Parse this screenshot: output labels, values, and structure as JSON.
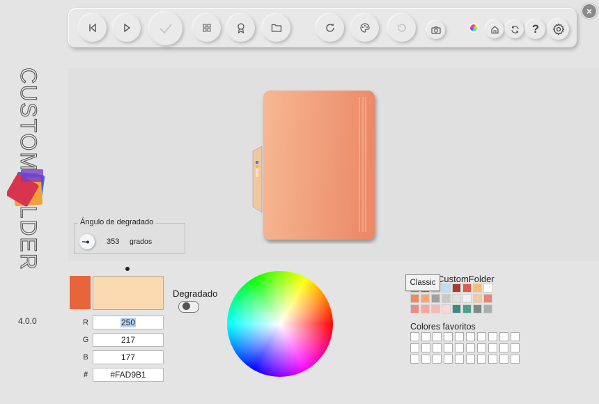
{
  "app": {
    "name": "CUSTOMFOLDER",
    "version": "4.0.0"
  },
  "window": {
    "close_icon": "close-icon"
  },
  "toolbar": {
    "buttons": [
      {
        "name": "previous",
        "icon": "skip-back-icon"
      },
      {
        "name": "play",
        "icon": "play-icon"
      },
      {
        "name": "apply",
        "icon": "check-icon"
      },
      {
        "name": "grid",
        "icon": "grid-icon"
      },
      {
        "name": "award",
        "icon": "award-icon"
      },
      {
        "name": "folder",
        "icon": "folder-icon"
      },
      {
        "name": "refresh",
        "icon": "refresh-icon"
      },
      {
        "name": "palette",
        "icon": "palette-icon"
      },
      {
        "name": "undo",
        "icon": "undo-icon"
      },
      {
        "name": "camera",
        "icon": "camera-icon"
      },
      {
        "name": "color-wheel",
        "icon": "color-wheel-icon"
      },
      {
        "name": "home",
        "icon": "home-icon"
      },
      {
        "name": "sync",
        "icon": "sync-icon"
      },
      {
        "name": "help",
        "icon": "help-icon"
      },
      {
        "name": "settings",
        "icon": "gear-icon"
      }
    ]
  },
  "gradient_angle": {
    "title": "Ángulo de degradado",
    "value": "353",
    "unit": "grados"
  },
  "color": {
    "main_swatch": "#E8643A",
    "current_swatch": "#FAD9B1",
    "r_label": "R",
    "r_value": "250",
    "g_label": "G",
    "g_value": "217",
    "b_label": "B",
    "b_value": "177",
    "hex_label": "#",
    "hex_value": "#FAD9B1"
  },
  "gradient_toggle": {
    "label": "Degradado",
    "on": false
  },
  "palettes": {
    "title": "CustomFolder",
    "tooltip": "Classic",
    "colors": [
      "#4aa0e0",
      "#3a7fd0",
      "#88c8f0",
      "#b8e0f8",
      "#a83a30",
      "#e05a48",
      "#f4c070",
      "#ffffff",
      "#f08a60",
      "#f4a878",
      "#a0a0a0",
      "#c8c8c8",
      "#e0e0e0",
      "#f0f0f0",
      "#f4c8a0",
      "#f08070",
      "#f08a80",
      "#f4a8a0",
      "#f8b8b8",
      "#f8d8d8",
      "#3a8a80",
      "#4aa090",
      "#808a88",
      "#a8b0ae"
    ]
  },
  "favorites": {
    "title": "Colores favoritos",
    "slots": 30
  }
}
